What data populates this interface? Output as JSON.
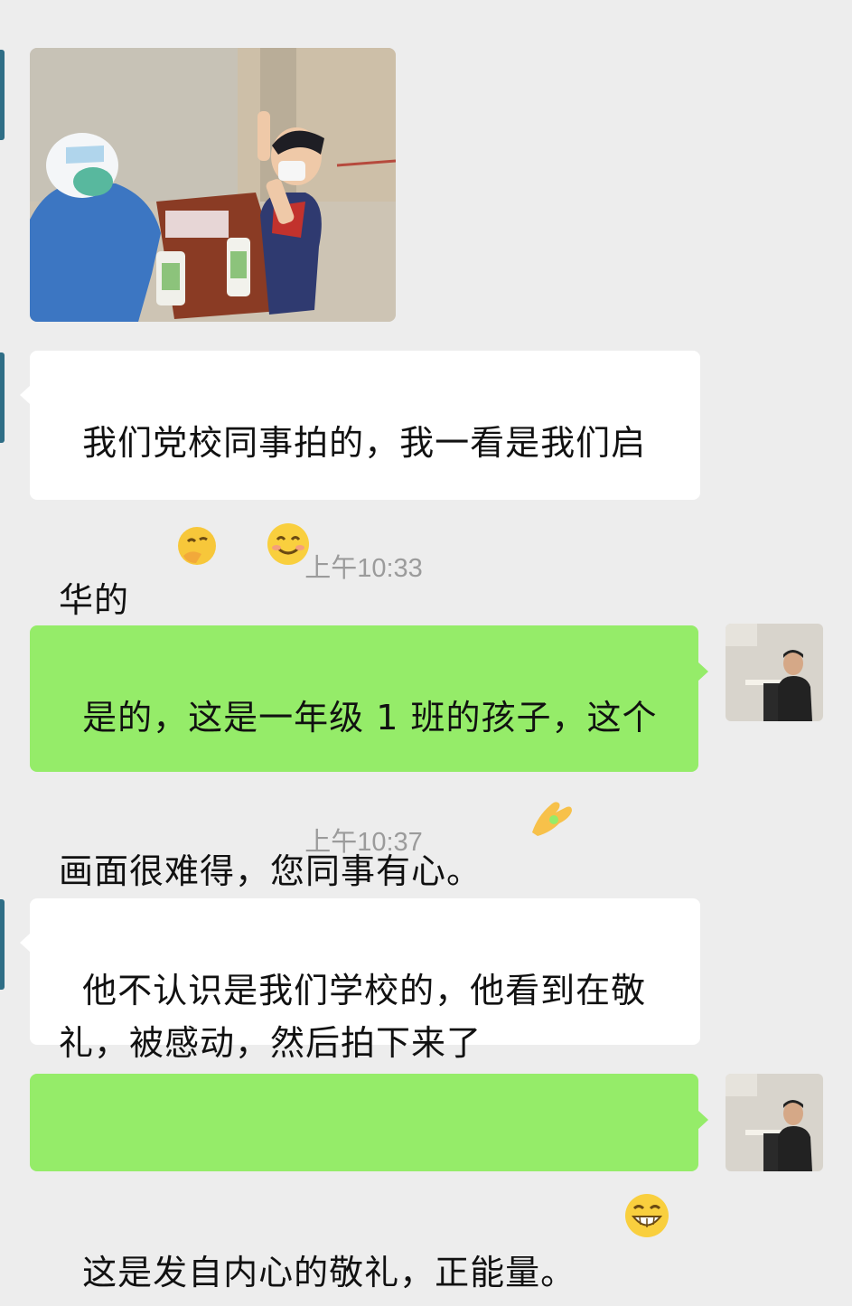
{
  "messages": {
    "m1_text": "我们党校同事拍的，我一看是我们启华的",
    "ts1": "上午10:33",
    "m2_text": "是的，这是一年级 1 班的孩子，这个画面很难得，您同事有心。",
    "ts2": "上午10:37",
    "m3_text": "他不认识是我们学校的，他看到在敬礼，被感动，然后拍下来了",
    "m4_text": "这是发自内心的敬礼，正能量。"
  },
  "icons": {
    "m1_emojis": [
      "thinking-face-icon",
      "smiling-face-icon"
    ],
    "m2_emoji": "ok-hand-icon",
    "m4_emoji": "grinning-face-icon"
  },
  "colors": {
    "background": "#ededed",
    "received_bubble": "#ffffff",
    "sent_bubble": "#95ec69",
    "timestamp": "#9b9b9b"
  }
}
